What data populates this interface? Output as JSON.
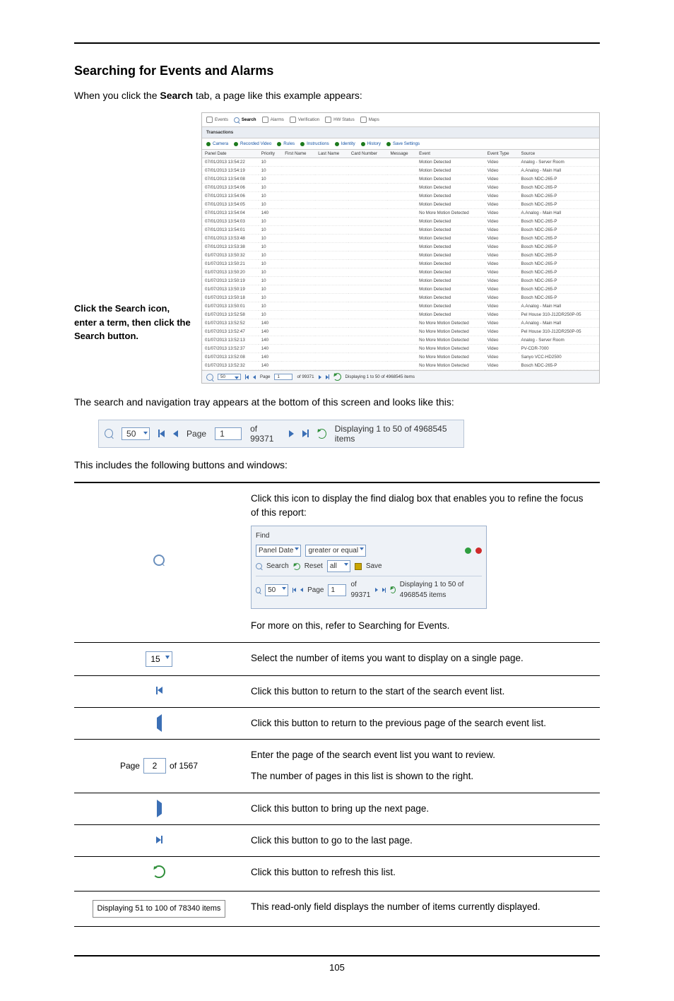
{
  "page_number": "105",
  "heading": "Searching for Events and Alarms",
  "intro_prefix": "When you click the ",
  "intro_bold": "Search",
  "intro_suffix": " tab, a page like this example appears:",
  "callout": "Click the Search icon, enter a term, then click the Search button.",
  "tray_text": "The search and navigation tray appears at the bottom of this screen and looks like this:",
  "buttons_intro": "This includes the following buttons and windows:",
  "shot": {
    "tabs": [
      "Events",
      "Search",
      "Alarms",
      "Verification",
      "HW Status",
      "Maps"
    ],
    "transactions": "Transactions",
    "filters": [
      "Camera",
      "Recorded Video",
      "Rules",
      "Instructions",
      "Identity",
      "History",
      "Save Settings"
    ],
    "columns": [
      "Panel Date",
      "Priority",
      "First Name",
      "Last Name",
      "Card Number",
      "Message",
      "Event",
      "Event Type",
      "Source"
    ],
    "rows": [
      {
        "date": "07/01/2013 13:54:22",
        "pri": "10",
        "event": "Motion Detected",
        "type": "Video",
        "src": "Analog - Server Room"
      },
      {
        "date": "07/01/2013 13:54:19",
        "pri": "10",
        "event": "Motion Detected",
        "type": "Video",
        "src": "A.Analog - Main Hall"
      },
      {
        "date": "07/01/2013 13:54:08",
        "pri": "10",
        "event": "Motion Detected",
        "type": "Video",
        "src": "Bosch NDC-265-P"
      },
      {
        "date": "07/01/2013 13:54:06",
        "pri": "10",
        "event": "Motion Detected",
        "type": "Video",
        "src": "Bosch NDC-265-P"
      },
      {
        "date": "07/01/2013 13:54:06",
        "pri": "10",
        "event": "Motion Detected",
        "type": "Video",
        "src": "Bosch NDC-265-P"
      },
      {
        "date": "07/01/2013 13:54:05",
        "pri": "10",
        "event": "Motion Detected",
        "type": "Video",
        "src": "Bosch NDC-265-P"
      },
      {
        "date": "07/01/2013 13:54:04",
        "pri": "140",
        "event": "No More Motion Detected",
        "type": "Video",
        "src": "A.Analog - Main Hall"
      },
      {
        "date": "07/01/2013 13:54:03",
        "pri": "10",
        "event": "Motion Detected",
        "type": "Video",
        "src": "Bosch NDC-265-P"
      },
      {
        "date": "07/01/2013 13:54:01",
        "pri": "10",
        "event": "Motion Detected",
        "type": "Video",
        "src": "Bosch NDC-265-P"
      },
      {
        "date": "07/01/2013 13:53:48",
        "pri": "10",
        "event": "Motion Detected",
        "type": "Video",
        "src": "Bosch NDC-265-P"
      },
      {
        "date": "07/01/2013 13:53:38",
        "pri": "10",
        "event": "Motion Detected",
        "type": "Video",
        "src": "Bosch NDC-265-P"
      },
      {
        "date": "01/07/2013 13:50:32",
        "pri": "10",
        "event": "Motion Detected",
        "type": "Video",
        "src": "Bosch NDC-265-P"
      },
      {
        "date": "01/07/2013 13:50:21",
        "pri": "10",
        "event": "Motion Detected",
        "type": "Video",
        "src": "Bosch NDC-265-P"
      },
      {
        "date": "01/07/2013 13:50:20",
        "pri": "10",
        "event": "Motion Detected",
        "type": "Video",
        "src": "Bosch NDC-265-P"
      },
      {
        "date": "01/07/2013 13:50:19",
        "pri": "10",
        "event": "Motion Detected",
        "type": "Video",
        "src": "Bosch NDC-265-P"
      },
      {
        "date": "01/07/2013 13:50:19",
        "pri": "10",
        "event": "Motion Detected",
        "type": "Video",
        "src": "Bosch NDC-265-P"
      },
      {
        "date": "01/07/2013 13:50:18",
        "pri": "10",
        "event": "Motion Detected",
        "type": "Video",
        "src": "Bosch NDC-265-P"
      },
      {
        "date": "01/07/2013 13:50:01",
        "pri": "10",
        "event": "Motion Detected",
        "type": "Video",
        "src": "A.Analog - Main Hall"
      },
      {
        "date": "01/07/2013 13:52:58",
        "pri": "10",
        "event": "Motion Detected",
        "type": "Video",
        "src": "Pel House 310-J12DR250P-05"
      },
      {
        "date": "01/07/2013 13:52:52",
        "pri": "140",
        "event": "No More Motion Detected",
        "type": "Video",
        "src": "A.Analog - Main Hall"
      },
      {
        "date": "01/07/2013 13:52:47",
        "pri": "140",
        "event": "No More Motion Detected",
        "type": "Video",
        "src": "Pel House 310-J12DR250P-05"
      },
      {
        "date": "01/07/2013 13:52:13",
        "pri": "140",
        "event": "No More Motion Detected",
        "type": "Video",
        "src": "Analog - Server Room"
      },
      {
        "date": "01/07/2013 13:52:37",
        "pri": "140",
        "event": "No More Motion Detected",
        "type": "Video",
        "src": "PV-CDR-7000"
      },
      {
        "date": "01/07/2013 13:52:08",
        "pri": "140",
        "event": "No More Motion Detected",
        "type": "Video",
        "src": "Sanyo VCC-HD2500"
      },
      {
        "date": "01/07/2013 13:52:32",
        "pri": "140",
        "event": "No More Motion Detected",
        "type": "Video",
        "src": "Bosch NDC-265-P"
      }
    ],
    "pager": {
      "size": "50",
      "page_label": "Page",
      "page": "1",
      "of_label": "of 99371",
      "disp": "Displaying 1 to 50 of 4968545 items"
    }
  },
  "tray": {
    "size": "50",
    "page_label": "Page",
    "page": "1",
    "of_label": "of 99371",
    "disp": "Displaying 1 to 50 of 4968545 items"
  },
  "table": {
    "find_para": "Click this icon to display the find dialog box that enables you to refine the focus of this report:",
    "find_footer": "For more on this, refer to Searching for Events.",
    "find_box": {
      "title": "Find",
      "field": "Panel Date",
      "op": "greater or equal",
      "search": "Search",
      "reset": "Reset",
      "all": "all",
      "save": "Save",
      "size": "50",
      "page_label": "Page",
      "page": "1",
      "of_label": "of 99371",
      "disp": "Displaying 1 to 50 of 4968545 items"
    },
    "sel15": "15",
    "sel15_text": "Select the number of items you want to display on a single page.",
    "first_text": "Click this button to return to the start of the search event list.",
    "prev_text": "Click this button to return to the previous page of the search event list.",
    "page_label": "Page",
    "page_val": "2",
    "of_label": "of 1567",
    "page_text1": "Enter the page of the search event list you want to review.",
    "page_text2": "The number of pages in this list is shown to the right.",
    "next_text": "Click this button to bring up the next page.",
    "last_text": "Click this button to go to the last page.",
    "refresh_text": "Click this button to refresh this list.",
    "disp_label": "Displaying 51 to 100 of 78340 items",
    "disp_text": "This read-only field displays the number of items currently displayed."
  }
}
